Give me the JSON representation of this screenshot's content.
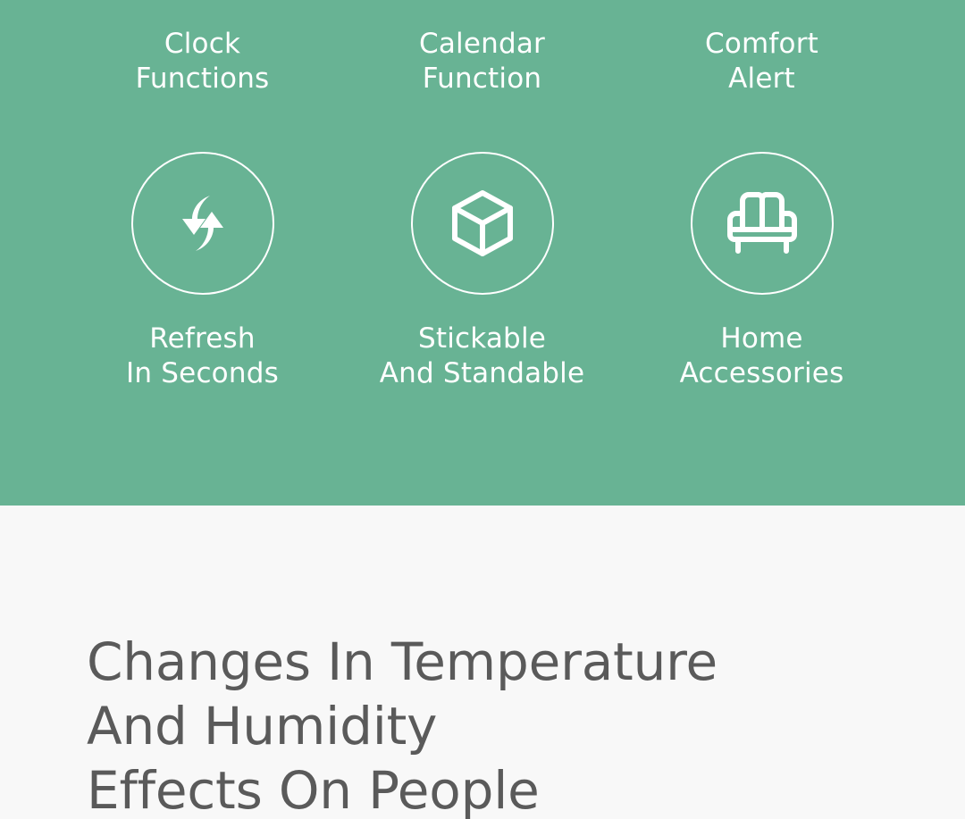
{
  "page": {
    "background_color": "#f8f8f8"
  },
  "feature_panel": {
    "background_color": "#68b394",
    "text_color": "#ffffff",
    "rows": [
      {
        "cells": [
          {
            "icon": "clock-icon",
            "label": "Clock\nFunctions"
          },
          {
            "icon": "calendar-icon",
            "label": "Calendar\nFunction"
          },
          {
            "icon": "comfort-alert-icon",
            "label": "Comfort\nAlert"
          }
        ]
      },
      {
        "cells": [
          {
            "icon": "refresh-arrows-icon",
            "label": "Refresh\nIn Seconds"
          },
          {
            "icon": "cube-icon",
            "label": "Stickable\nAnd Standable"
          },
          {
            "icon": "sofa-icon",
            "label": "Home\nAccessories"
          }
        ]
      }
    ]
  },
  "info_section": {
    "background_color": "#f8f8f8",
    "heading": "Changes In Temperature\nAnd Humidity\nEffects On People",
    "heading_color": "#5a5a5a"
  }
}
